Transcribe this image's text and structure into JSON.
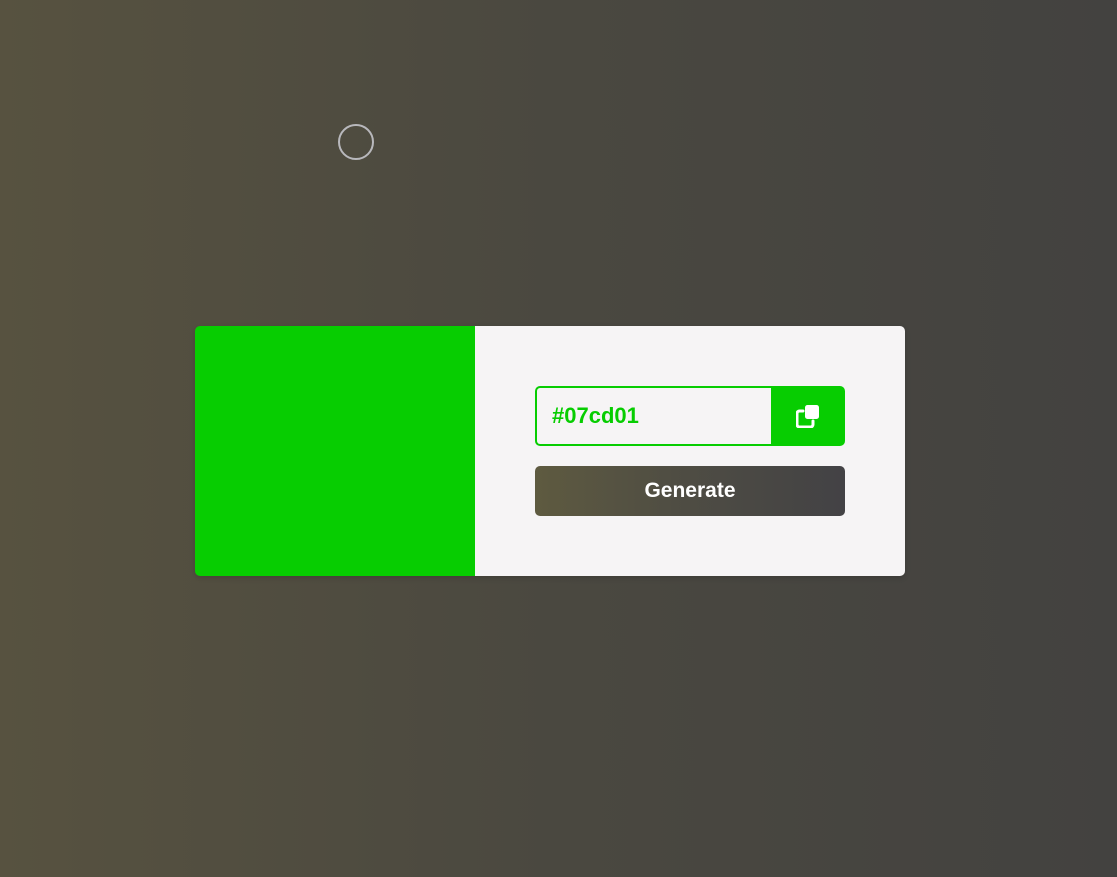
{
  "colors": {
    "current": "#07cd01",
    "panel_bg": "#f6f4f5",
    "button_text": "#ffffff"
  },
  "generator": {
    "hex_value": "#07cd01",
    "copy_icon": "copy-icon",
    "generate_label": "Generate"
  }
}
